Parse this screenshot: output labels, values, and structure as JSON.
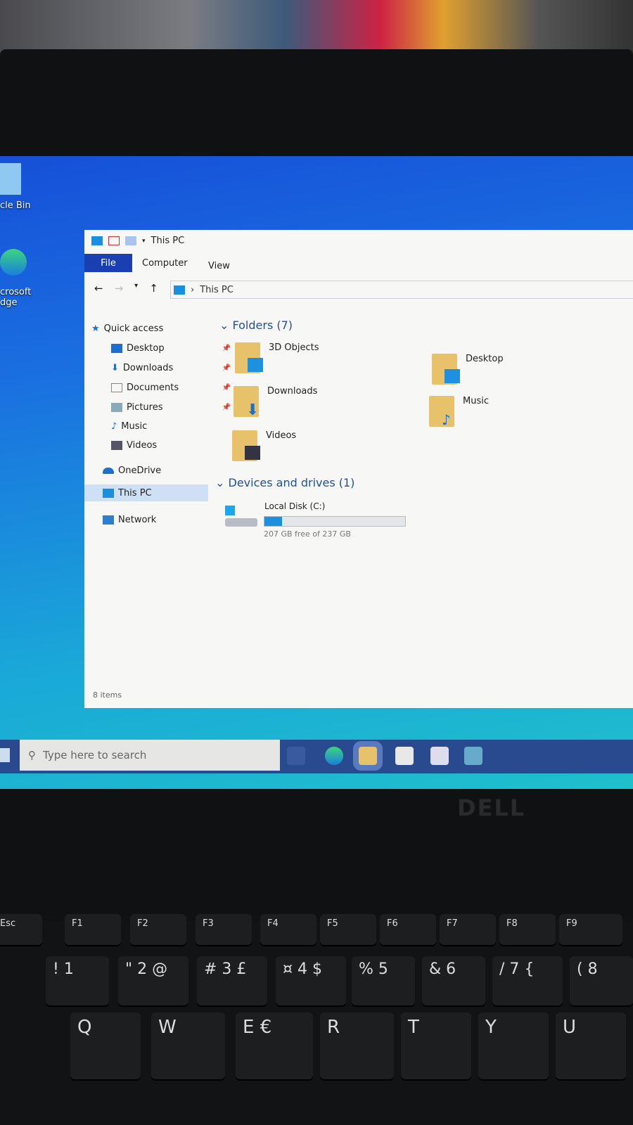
{
  "desktop": {
    "icons": [
      {
        "label": "cle Bin"
      },
      {
        "label": "crosoft\ndge"
      }
    ]
  },
  "window": {
    "title": "This PC",
    "ribbon_tabs": [
      "File",
      "Computer",
      "View"
    ],
    "address": {
      "path": "This PC"
    },
    "nav": [
      {
        "label": "Quick access",
        "icon": "star-icon"
      },
      {
        "label": "Desktop",
        "icon": "desktop-icon",
        "pinned": true
      },
      {
        "label": "Downloads",
        "icon": "download-icon",
        "pinned": true
      },
      {
        "label": "Documents",
        "icon": "document-icon",
        "pinned": true
      },
      {
        "label": "Pictures",
        "icon": "picture-icon",
        "pinned": true
      },
      {
        "label": "Music",
        "icon": "music-icon"
      },
      {
        "label": "Videos",
        "icon": "video-icon"
      },
      {
        "label": "OneDrive",
        "icon": "cloud-icon"
      },
      {
        "label": "This PC",
        "icon": "computer-icon",
        "selected": true
      },
      {
        "label": "Network",
        "icon": "network-icon"
      }
    ],
    "folders_header": "Folders (7)",
    "folders": [
      {
        "label": "3D Objects"
      },
      {
        "label": "Desktop"
      },
      {
        "label": "Downloads"
      },
      {
        "label": "Music"
      },
      {
        "label": "Videos"
      }
    ],
    "drives_header": "Devices and drives (1)",
    "drive": {
      "label": "Local Disk (C:)",
      "space": "207 GB free of 237 GB",
      "used_percent": 12.7
    },
    "status": "8 items"
  },
  "taskbar": {
    "search_placeholder": "Type here to search",
    "apps": [
      "task-view-icon",
      "edge-icon",
      "file-explorer-icon",
      "store-icon",
      "mail-icon",
      "app-icon"
    ]
  },
  "laptop": {
    "brand": "DELL",
    "fkeys": [
      "Esc",
      "F1",
      "F2",
      "F3",
      "F4",
      "F5",
      "F6",
      "F7",
      "F8",
      "F9"
    ],
    "number_keys": [
      "! 1",
      "\" 2 @",
      "# 3 £",
      "¤ 4 $",
      "% 5",
      "& 6",
      "/ 7 {",
      "( 8"
    ],
    "letter_keys": [
      "Q",
      "W",
      "E €",
      "R",
      "T",
      "Y",
      "U"
    ]
  }
}
